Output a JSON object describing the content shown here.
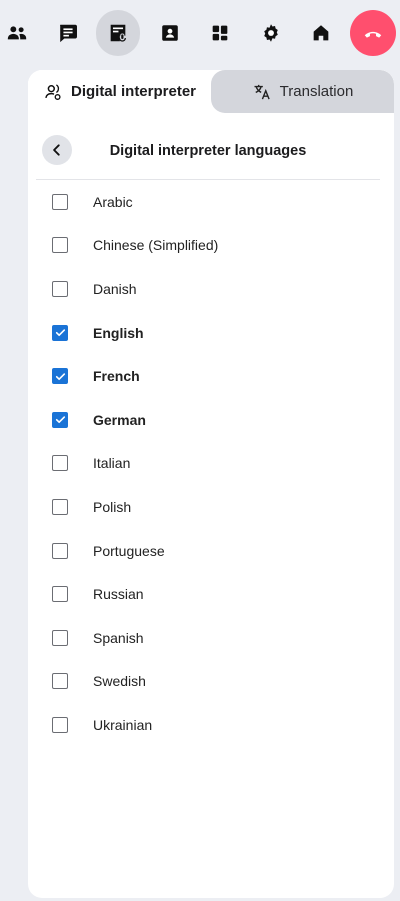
{
  "toolbar": {
    "buttons": [
      {
        "name": "participants-icon"
      },
      {
        "name": "chat-icon"
      },
      {
        "name": "interpreter-icon"
      },
      {
        "name": "contact-card-icon"
      },
      {
        "name": "apps-grid-icon"
      },
      {
        "name": "settings-gear-icon"
      },
      {
        "name": "home-icon"
      },
      {
        "name": "hang-up-icon"
      }
    ],
    "active_index": 2,
    "hangup_color": "#ff4f6e"
  },
  "tabs": {
    "digital_interpreter": "Digital interpreter",
    "translation": "Translation"
  },
  "panel": {
    "title": "Digital interpreter languages"
  },
  "languages": [
    {
      "label": "Arabic",
      "checked": false
    },
    {
      "label": "Chinese (Simplified)",
      "checked": false
    },
    {
      "label": "Danish",
      "checked": false
    },
    {
      "label": "English",
      "checked": true
    },
    {
      "label": "French",
      "checked": true
    },
    {
      "label": "German",
      "checked": true
    },
    {
      "label": "Italian",
      "checked": false
    },
    {
      "label": "Polish",
      "checked": false
    },
    {
      "label": "Portuguese",
      "checked": false
    },
    {
      "label": "Russian",
      "checked": false
    },
    {
      "label": "Spanish",
      "checked": false
    },
    {
      "label": "Swedish",
      "checked": false
    },
    {
      "label": "Ukrainian",
      "checked": false
    }
  ],
  "colors": {
    "accent": "#1a73d6",
    "tab_inactive_bg": "#d4d6dc",
    "page_bg": "#eceef3"
  }
}
